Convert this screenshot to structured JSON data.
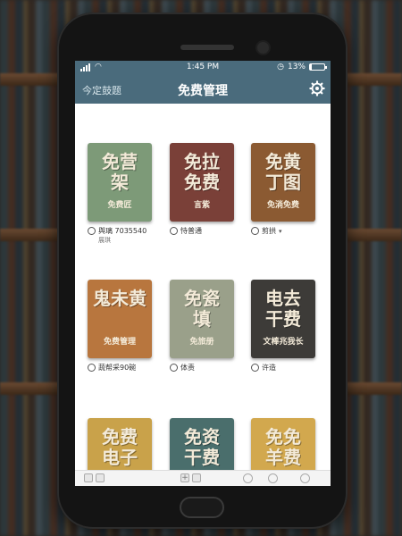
{
  "status_bar": {
    "time": "1:45 PM",
    "battery": "13%",
    "battery_level": 0.13
  },
  "nav": {
    "back_label": "今定鼓题",
    "title": "免费管理",
    "settings_icon": "gear-icon"
  },
  "books": [
    {
      "line1": "免营",
      "line2": "架",
      "sub": "免费匠",
      "sub2": "",
      "bg": "#7d9a78",
      "caption": "舆璃 7035540",
      "caption2": "展琪",
      "icon": "person-icon"
    },
    {
      "line1": "免拉",
      "line2": "免费",
      "sub": "言紫",
      "sub2": "",
      "bg": "#7a4038",
      "caption": "恃普通",
      "caption2": "",
      "icon": "brush-icon"
    },
    {
      "line1": "免黄",
      "line2": "丁图",
      "sub": "免淌免费",
      "sub2": "",
      "bg": "#8b5a32",
      "caption": "剪拱",
      "caption2": "",
      "icon": "person-icon",
      "caret": "▾"
    },
    {
      "line1": "鬼未黄",
      "line2": "",
      "sub": "免费管理",
      "sub2": "",
      "bg": "#b8763e",
      "caption": "蔬帮采90碗",
      "caption2": "",
      "icon": "person-icon"
    },
    {
      "line1": "免瓷",
      "line2": "填",
      "sub": "免旅册",
      "sub2": "",
      "bg": "#9aa08a",
      "caption": "体责",
      "caption2": "",
      "icon": "arrow-icon"
    },
    {
      "line1": "电去",
      "line2": "干费",
      "sub": "文棒兆我长",
      "sub2": "",
      "bg": "#3d3b38",
      "caption": "许造",
      "caption2": "",
      "icon": "person-icon"
    },
    {
      "line1": "免费",
      "line2": "电子",
      "sub": "",
      "sub2": "",
      "bg": "#c9a24a",
      "caption": "",
      "caption2": "",
      "icon": ""
    },
    {
      "line1": "免资",
      "line2": "干费",
      "sub": "",
      "sub2": "",
      "bg": "#4a6e6c",
      "caption": "",
      "caption2": "",
      "icon": ""
    },
    {
      "line1": "免免",
      "line2": "羊费",
      "sub": "",
      "sub2": "",
      "bg": "#d2a84e",
      "caption": "",
      "caption2": "",
      "icon": ""
    }
  ],
  "toolbar": {
    "icons": [
      "grid-icon",
      "add-icon",
      "circle-icon",
      "info-icon",
      "share-icon"
    ]
  }
}
